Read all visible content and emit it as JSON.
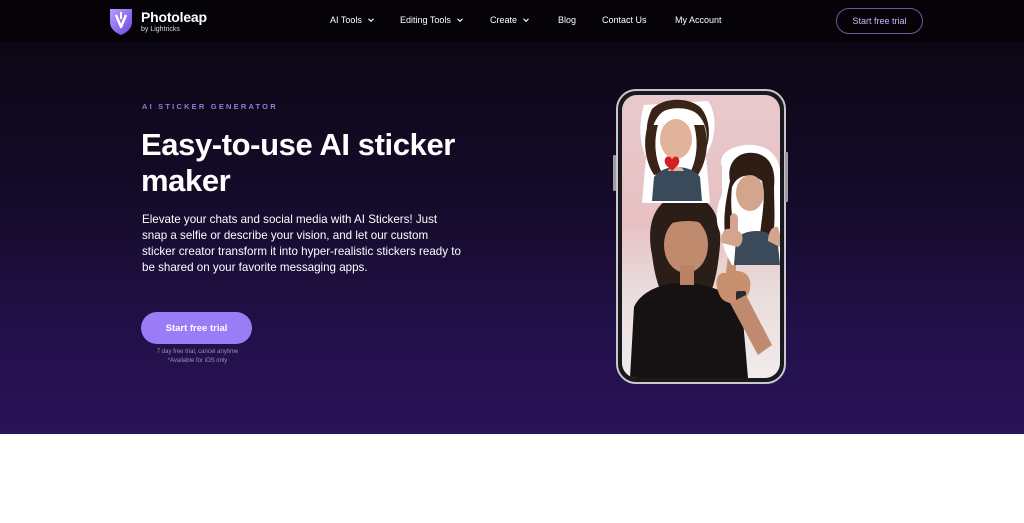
{
  "brand": {
    "name": "Photoleap",
    "subtitle": "by Lightricks",
    "accent": "#9a7cf6"
  },
  "nav": {
    "items": [
      {
        "label": "AI Tools",
        "dropdown": true
      },
      {
        "label": "Editing Tools",
        "dropdown": true
      },
      {
        "label": "Create",
        "dropdown": true
      },
      {
        "label": "Blog",
        "dropdown": false
      },
      {
        "label": "Contact Us",
        "dropdown": false
      },
      {
        "label": "My Account",
        "dropdown": false
      }
    ],
    "cta_label": "Start free trial"
  },
  "hero": {
    "eyebrow": "AI STICKER GENERATOR",
    "title": "Easy-to-use AI sticker maker",
    "description": "Elevate your chats and social media with AI Stickers! Just snap a selfie or describe your vision, and let our custom sticker creator transform it into hyper-realistic stickers ready to be shared on your favorite messaging apps.",
    "cta_label": "Start free trial",
    "fine_print_1": "7 day free trial, cancel anytime",
    "fine_print_2": "*Available for iOS only"
  },
  "icons": {
    "logo": "photoleap-logo-icon",
    "chevron": "chevron-down-icon"
  }
}
